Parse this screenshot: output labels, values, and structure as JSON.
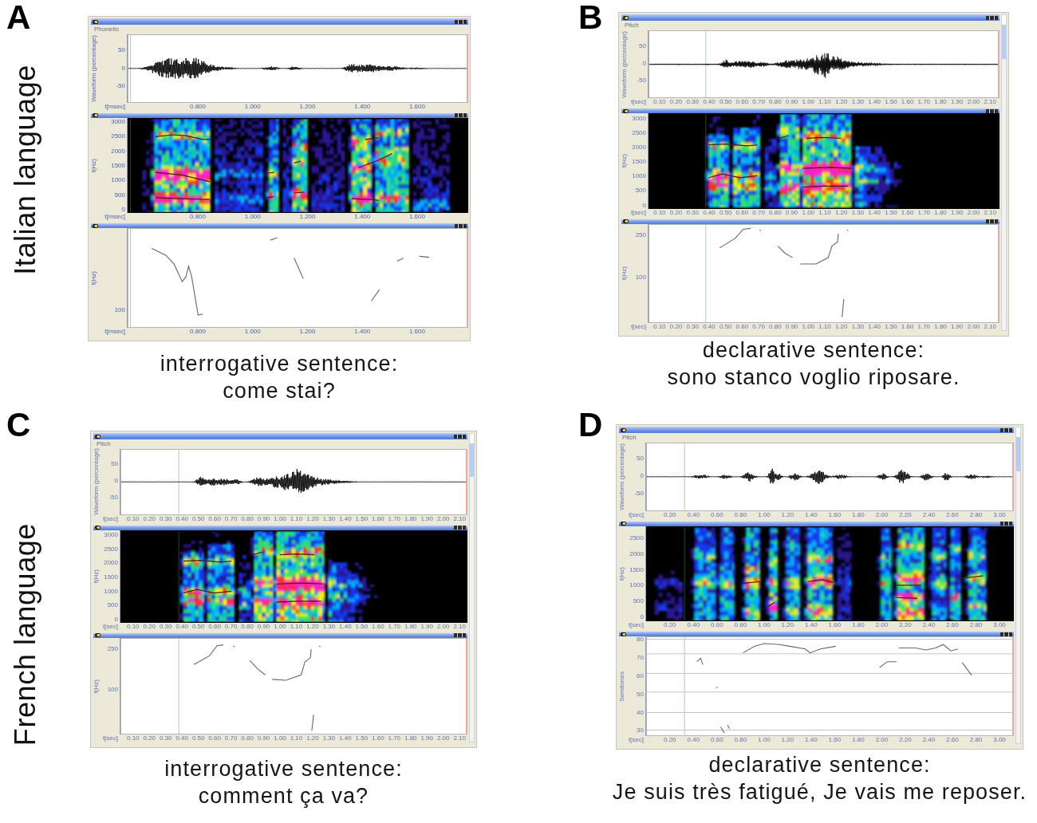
{
  "rows": [
    {
      "label": "Italian language",
      "panels": [
        {
          "letter": "A",
          "window": {
            "view": "Phonetic",
            "panes": [
              {
                "kind": "waveform",
                "ylabel": "Waveform (percentage)",
                "yticks": [
                  "50",
                  "0",
                  "-50"
                ],
                "xunit": "t[msec]",
                "xticks": [
                  "0.800",
                  "1.000",
                  "1.200",
                  "1.400",
                  "1.600"
                ]
              },
              {
                "kind": "spectrogram",
                "ylabel": "f(Hz)",
                "yticks": [
                  "3000",
                  "2500",
                  "2000",
                  "1500",
                  "1000",
                  "500",
                  "0"
                ],
                "xunit": "t[msec]",
                "xticks": [
                  "0.800",
                  "1.000",
                  "1.200",
                  "1.400",
                  "1.600"
                ]
              },
              {
                "kind": "pitch",
                "ylabel": "f(Hz)",
                "yticks": [
                  "100"
                ],
                "xunit": "t[msec]",
                "xticks": [
                  "0.800",
                  "1.000",
                  "1.200",
                  "1.400",
                  "1.600"
                ]
              }
            ]
          },
          "caption": {
            "type": "interrogative sentence:",
            "sentence": "come stai?"
          }
        },
        {
          "letter": "B",
          "window": {
            "view": "Pitch",
            "scrollbar": true,
            "panes": [
              {
                "kind": "waveform",
                "ylabel": "Waveform (percentage)",
                "yticks": [
                  "50",
                  "0",
                  "-50"
                ],
                "xunit": "t[sec]",
                "xticks": [
                  "0.10",
                  "0.20",
                  "0.30",
                  "0.40",
                  "0.50",
                  "0.60",
                  "0.70",
                  "0.80",
                  "0.90",
                  "1.00",
                  "1.10",
                  "1.20",
                  "1.30",
                  "1.40",
                  "1.50",
                  "1.60",
                  "1.70",
                  "1.80",
                  "1.90",
                  "2.00",
                  "2.10"
                ]
              },
              {
                "kind": "spectrogram",
                "ylabel": "f(Hz)",
                "yticks": [
                  "3000",
                  "2500",
                  "2000",
                  "1500",
                  "1000",
                  "500",
                  "0"
                ],
                "xunit": "t[sec]",
                "xticks": [
                  "0.10",
                  "0.20",
                  "0.30",
                  "0.40",
                  "0.50",
                  "0.60",
                  "0.70",
                  "0.80",
                  "0.90",
                  "1.00",
                  "1.10",
                  "1.20",
                  "1.30",
                  "1.40",
                  "1.50",
                  "1.60",
                  "1.70",
                  "1.80",
                  "1.90",
                  "2.00",
                  "2.10"
                ]
              },
              {
                "kind": "pitch",
                "ylabel": "f(Hz)",
                "yticks": [
                  "250",
                  "100"
                ],
                "xunit": "t[sec]",
                "xticks": [
                  "0.10",
                  "0.20",
                  "0.30",
                  "0.40",
                  "0.50",
                  "0.60",
                  "0.70",
                  "0.80",
                  "0.90",
                  "1.00",
                  "1.10",
                  "1.20",
                  "1.30",
                  "1.40",
                  "1.50",
                  "1.60",
                  "1.70",
                  "1.80",
                  "1.90",
                  "2.00",
                  "2.10"
                ]
              }
            ]
          },
          "caption": {
            "type": "declarative sentence:",
            "sentence": "sono stanco voglio riposare."
          }
        }
      ]
    },
    {
      "label": "French language",
      "panels": [
        {
          "letter": "C",
          "window": {
            "view": "Pitch",
            "scrollbar": true,
            "panes": [
              {
                "kind": "waveform",
                "ylabel": "Waveform (percentage)",
                "yticks": [
                  "50",
                  "0",
                  "-50"
                ],
                "xunit": "t[sec]",
                "xticks": [
                  "0.10",
                  "0.20",
                  "0.30",
                  "0.40",
                  "0.50",
                  "0.60",
                  "0.70",
                  "0.80",
                  "0.90",
                  "1.00",
                  "1.10",
                  "1.20",
                  "1.30",
                  "1.40",
                  "1.50",
                  "1.60",
                  "1.70",
                  "1.80",
                  "1.90",
                  "2.00",
                  "2.10"
                ]
              },
              {
                "kind": "spectrogram",
                "ylabel": "f(Hz)",
                "yticks": [
                  "3000",
                  "2500",
                  "2000",
                  "1500",
                  "1000",
                  "500",
                  "0"
                ],
                "xunit": "t[sec]",
                "xticks": [
                  "0.10",
                  "0.20",
                  "0.30",
                  "0.40",
                  "0.50",
                  "0.60",
                  "0.70",
                  "0.80",
                  "0.90",
                  "1.00",
                  "1.10",
                  "1.20",
                  "1.30",
                  "1.40",
                  "1.50",
                  "1.60",
                  "1.70",
                  "1.80",
                  "1.90",
                  "2.00",
                  "2.10"
                ]
              },
              {
                "kind": "pitch",
                "ylabel": "f(Hz)",
                "yticks": [
                  "250",
                  "100"
                ],
                "xunit": "t[sec]",
                "xticks": [
                  "0.10",
                  "0.20",
                  "0.30",
                  "0.40",
                  "0.50",
                  "0.60",
                  "0.70",
                  "0.80",
                  "0.90",
                  "1.00",
                  "1.10",
                  "1.20",
                  "1.30",
                  "1.40",
                  "1.50",
                  "1.60",
                  "1.70",
                  "1.80",
                  "1.90",
                  "2.00",
                  "2.10"
                ]
              }
            ]
          },
          "caption": {
            "type": "interrogative sentence:",
            "sentence": "comment ça va?"
          }
        },
        {
          "letter": "D",
          "window": {
            "view": "Pitch",
            "scrollbar": true,
            "panes": [
              {
                "kind": "waveform",
                "ylabel": "Waveform (percentage)",
                "yticks": [
                  "50",
                  "0",
                  "-50"
                ],
                "xunit": "t[sec]",
                "xticks": [
                  "0.20",
                  "0.40",
                  "0.60",
                  "0.80",
                  "1.00",
                  "1.20",
                  "1.40",
                  "1.60",
                  "1.80",
                  "2.00",
                  "2.20",
                  "2.40",
                  "2.60",
                  "2.80",
                  "3.00"
                ]
              },
              {
                "kind": "spectrogram",
                "ylabel": "f(Hz)",
                "yticks": [
                  "2500",
                  "2000",
                  "1500",
                  "1000",
                  "500",
                  "0"
                ],
                "xunit": "t[sec]",
                "xticks": [
                  "0.20",
                  "0.40",
                  "0.60",
                  "0.80",
                  "1.00",
                  "1.20",
                  "1.40",
                  "1.60",
                  "1.80",
                  "2.00",
                  "2.20",
                  "2.40",
                  "2.60",
                  "2.80",
                  "3.00"
                ]
              },
              {
                "kind": "pitch",
                "ylabel": "Semitones",
                "yticks": [
                  "80",
                  "70",
                  "60",
                  "50",
                  "40",
                  "30"
                ],
                "gridlines": true,
                "xunit": "t[sec]",
                "xticks": [
                  "0.20",
                  "0.40",
                  "0.60",
                  "0.80",
                  "1.00",
                  "1.20",
                  "1.40",
                  "1.60",
                  "1.80",
                  "2.00",
                  "2.20",
                  "2.40",
                  "2.60",
                  "2.80",
                  "3.00"
                ]
              }
            ]
          },
          "caption": {
            "type": "declarative sentence:",
            "sentence": "Je suis très fatigué, Je vais me reposer."
          }
        }
      ]
    }
  ]
}
